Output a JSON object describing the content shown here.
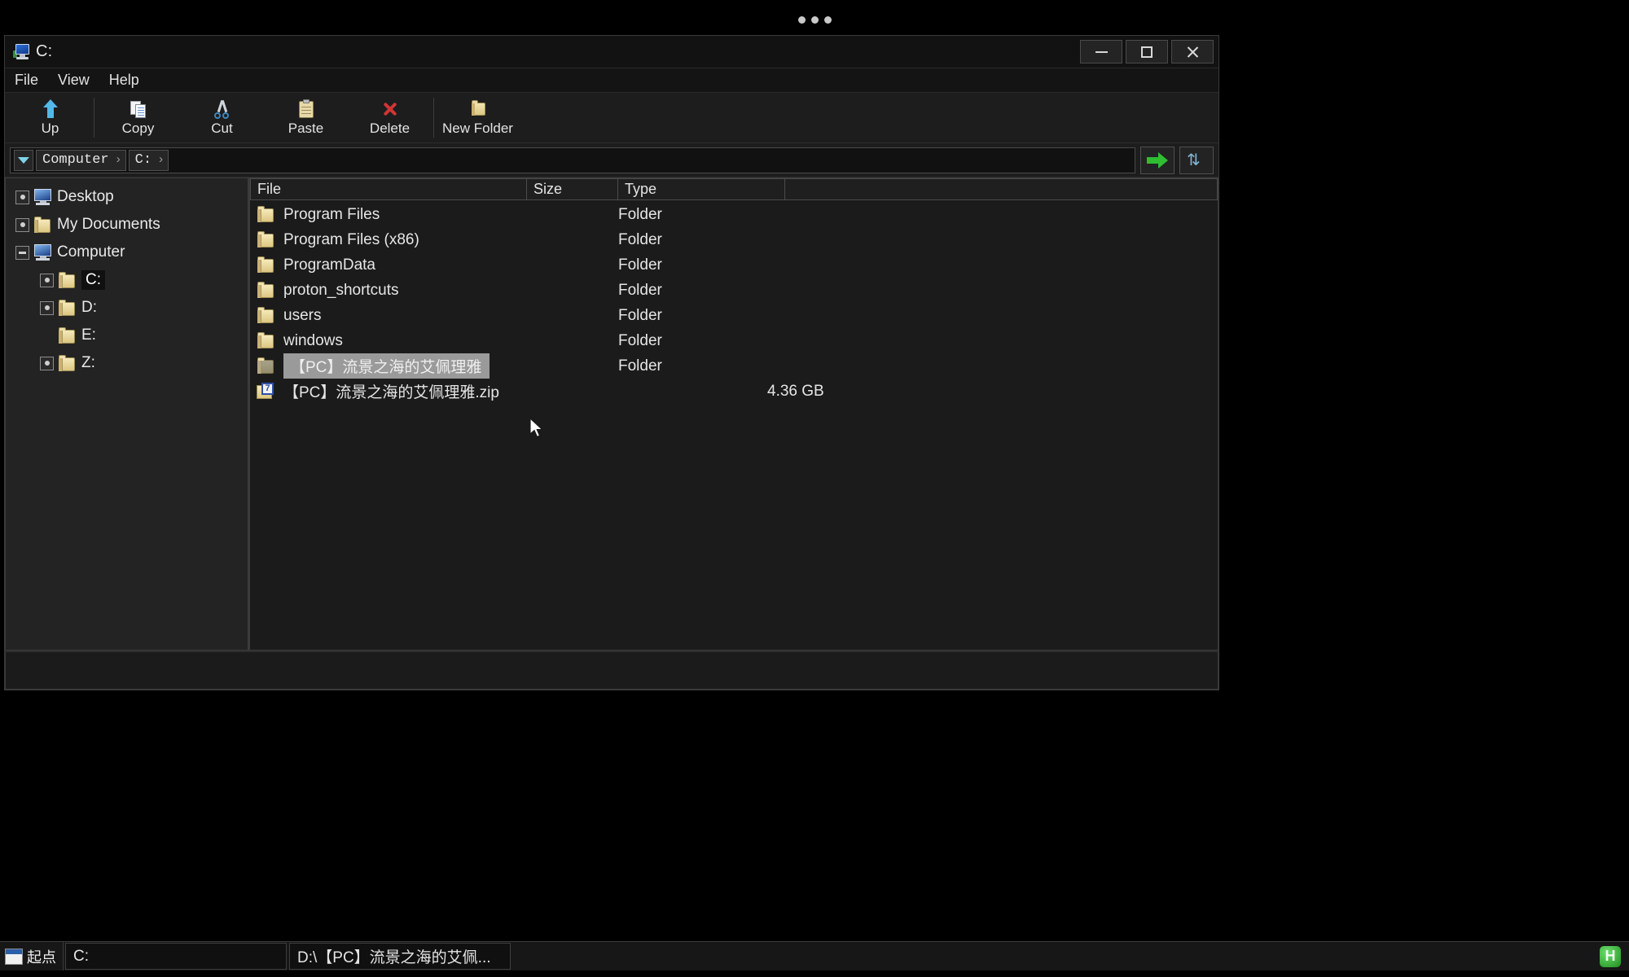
{
  "window": {
    "title": "C:",
    "title_icon": "computer-drive-icon",
    "controls": {
      "minimize": "minimize-icon",
      "maximize": "maximize-icon",
      "close": "close-icon"
    }
  },
  "menu": {
    "items": [
      "File",
      "View",
      "Help"
    ]
  },
  "toolbar": {
    "items": [
      {
        "label": "Up",
        "icon": "up-arrow-icon"
      },
      {
        "label": "Copy",
        "icon": "copy-icon"
      },
      {
        "label": "Cut",
        "icon": "scissors-icon"
      },
      {
        "label": "Paste",
        "icon": "clipboard-icon"
      },
      {
        "label": "Delete",
        "icon": "red-x-icon"
      },
      {
        "label": "New Folder",
        "icon": "new-folder-icon"
      }
    ]
  },
  "address": {
    "dropdown_icon": "chevron-down-icon",
    "crumbs": [
      {
        "label": "Computer",
        "chevron": "›"
      },
      {
        "label": "C:",
        "chevron": "›"
      }
    ],
    "go_label": "go-arrow-icon",
    "refresh_label": "refresh-icon"
  },
  "tree": {
    "items": [
      {
        "label": "Desktop",
        "icon": "monitor-icon",
        "expander": "plus",
        "indent": 0,
        "selected": false
      },
      {
        "label": "My Documents",
        "icon": "folder-icon",
        "expander": "plus",
        "indent": 0,
        "selected": false
      },
      {
        "label": "Computer",
        "icon": "monitor-icon",
        "expander": "minus",
        "indent": 0,
        "selected": false
      },
      {
        "label": "C:",
        "icon": "folder-icon",
        "expander": "plus",
        "indent": 1,
        "selected": true
      },
      {
        "label": "D:",
        "icon": "folder-icon",
        "expander": "plus",
        "indent": 1,
        "selected": false
      },
      {
        "label": "E:",
        "icon": "folder-icon",
        "expander": "none",
        "indent": 1,
        "selected": false
      },
      {
        "label": "Z:",
        "icon": "folder-icon",
        "expander": "plus",
        "indent": 1,
        "selected": false
      }
    ]
  },
  "list": {
    "columns": [
      "File",
      "Size",
      "Type",
      ""
    ],
    "rows": [
      {
        "name": "Program Files",
        "size": "",
        "type": "Folder",
        "icon": "folder-icon",
        "selected": false
      },
      {
        "name": "Program Files (x86)",
        "size": "",
        "type": "Folder",
        "icon": "folder-icon",
        "selected": false
      },
      {
        "name": "ProgramData",
        "size": "",
        "type": "Folder",
        "icon": "folder-icon",
        "selected": false
      },
      {
        "name": "proton_shortcuts",
        "size": "",
        "type": "Folder",
        "icon": "folder-icon",
        "selected": false
      },
      {
        "name": "users",
        "size": "",
        "type": "Folder",
        "icon": "folder-icon",
        "selected": false
      },
      {
        "name": "windows",
        "size": "",
        "type": "Folder",
        "icon": "folder-icon",
        "selected": false
      },
      {
        "name": "【PC】流景之海的艾佩理雅",
        "size": "",
        "type": "Folder",
        "icon": "folder-icon-dim",
        "selected": true
      },
      {
        "name": "【PC】流景之海的艾佩理雅.zip",
        "size": "4.36 GB",
        "type": "",
        "icon": "zip-archive-icon",
        "selected": false
      }
    ]
  },
  "taskbar": {
    "start_label": "起点",
    "buttons": [
      {
        "label": "C:"
      },
      {
        "label": "D:\\【PC】流景之海的艾佩..."
      }
    ],
    "tray": [
      {
        "label": "H",
        "name": "tray-h-icon"
      }
    ]
  },
  "colors": {
    "accent_cyan": "#7fd3e8",
    "go_green": "#2fbd32",
    "delete_red": "#cf3535",
    "folder_yellow": "#dcc782",
    "selection_gray": "#9a9a9a",
    "window_bg": "#1b1b1b"
  }
}
